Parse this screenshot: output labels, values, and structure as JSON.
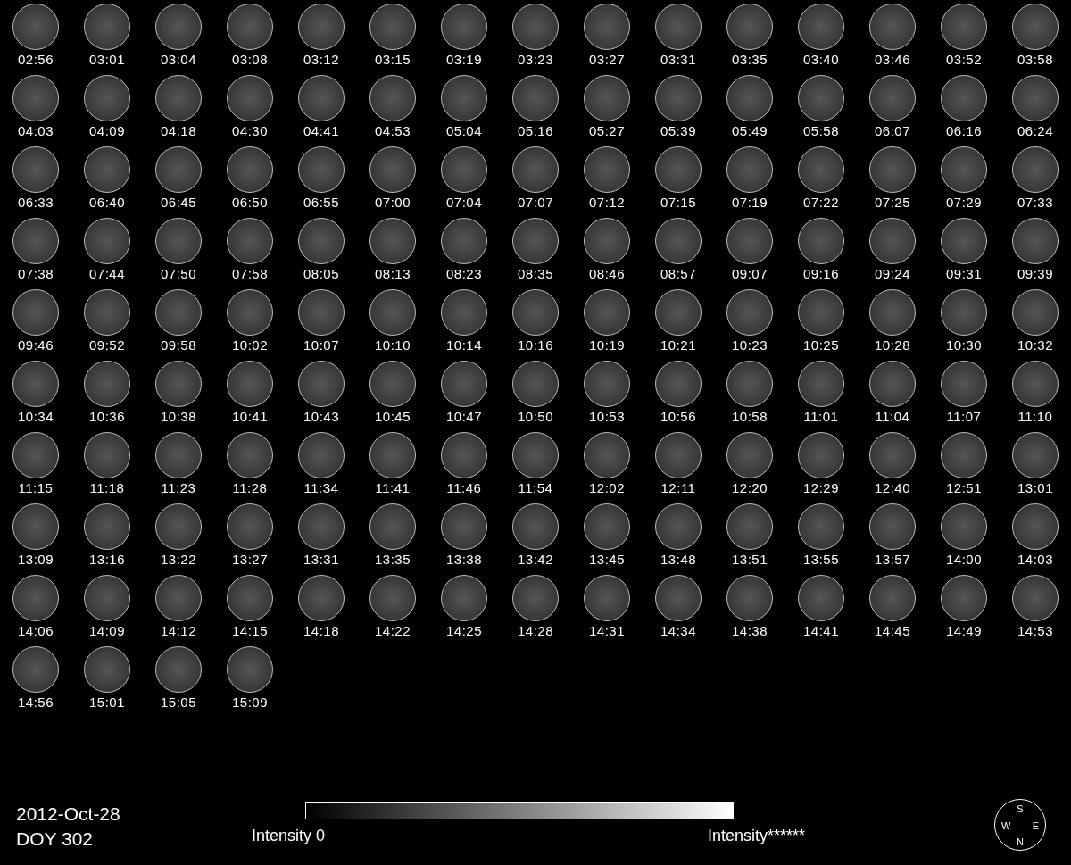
{
  "frame_times": [
    "02:56",
    "03:01",
    "03:04",
    "03:08",
    "03:12",
    "03:15",
    "03:19",
    "03:23",
    "03:27",
    "03:31",
    "03:35",
    "03:40",
    "03:46",
    "03:52",
    "03:58",
    "04:03",
    "04:09",
    "04:18",
    "04:30",
    "04:41",
    "04:53",
    "05:04",
    "05:16",
    "05:27",
    "05:39",
    "05:49",
    "05:58",
    "06:07",
    "06:16",
    "06:24",
    "06:33",
    "06:40",
    "06:45",
    "06:50",
    "06:55",
    "07:00",
    "07:04",
    "07:07",
    "07:12",
    "07:15",
    "07:19",
    "07:22",
    "07:25",
    "07:29",
    "07:33",
    "07:38",
    "07:44",
    "07:50",
    "07:58",
    "08:05",
    "08:13",
    "08:23",
    "08:35",
    "08:46",
    "08:57",
    "09:07",
    "09:16",
    "09:24",
    "09:31",
    "09:39",
    "09:46",
    "09:52",
    "09:58",
    "10:02",
    "10:07",
    "10:10",
    "10:14",
    "10:16",
    "10:19",
    "10:21",
    "10:23",
    "10:25",
    "10:28",
    "10:30",
    "10:32",
    "10:34",
    "10:36",
    "10:38",
    "10:41",
    "10:43",
    "10:45",
    "10:47",
    "10:50",
    "10:53",
    "10:56",
    "10:58",
    "11:01",
    "11:04",
    "11:07",
    "11:10",
    "11:15",
    "11:18",
    "11:23",
    "11:28",
    "11:34",
    "11:41",
    "11:46",
    "11:54",
    "12:02",
    "12:11",
    "12:20",
    "12:29",
    "12:40",
    "12:51",
    "13:01",
    "13:09",
    "13:16",
    "13:22",
    "13:27",
    "13:31",
    "13:35",
    "13:38",
    "13:42",
    "13:45",
    "13:48",
    "13:51",
    "13:55",
    "13:57",
    "14:00",
    "14:03",
    "14:06",
    "14:09",
    "14:12",
    "14:15",
    "14:18",
    "14:22",
    "14:25",
    "14:28",
    "14:31",
    "14:34",
    "14:38",
    "14:41",
    "14:45",
    "14:49",
    "14:53",
    "14:56",
    "15:01",
    "15:05",
    "15:09"
  ],
  "footer": {
    "date": "2012-Oct-28",
    "doy": "DOY 302"
  },
  "colorbar": {
    "min_label": "Intensity 0",
    "max_label": "Intensity******"
  },
  "compass": {
    "top": "S",
    "left": "W",
    "right": "E",
    "bottom": "N"
  }
}
